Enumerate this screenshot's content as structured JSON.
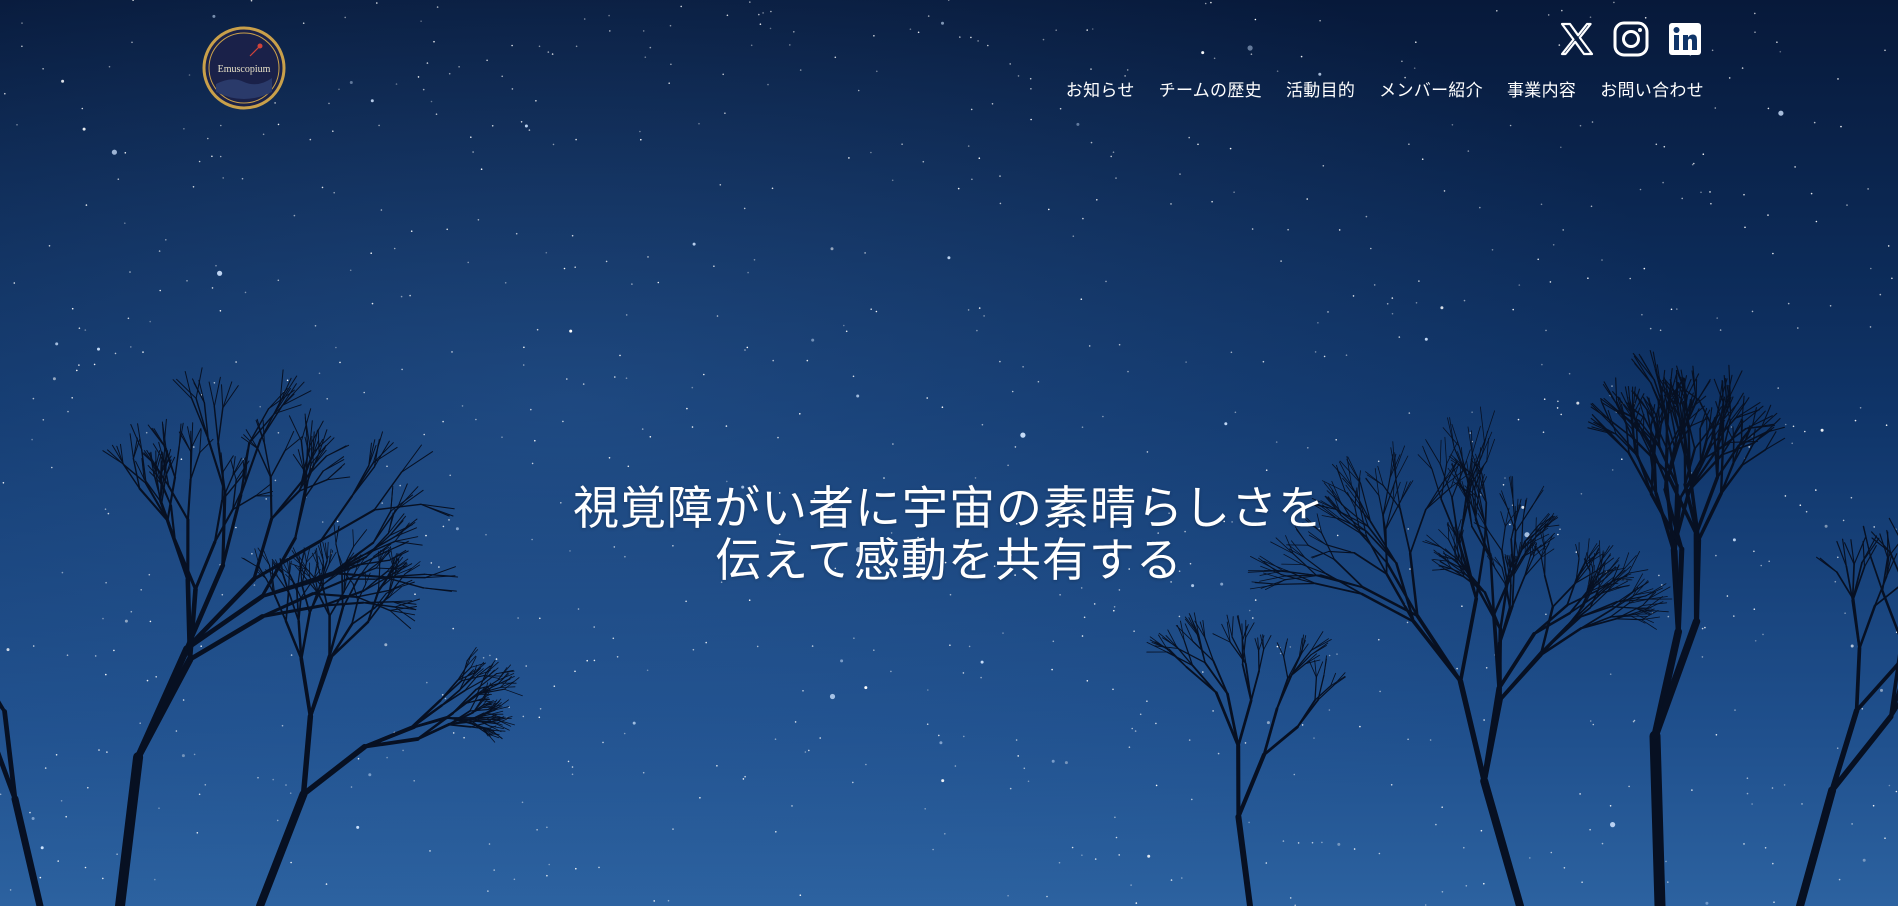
{
  "logo": {
    "text": "Emuscopium"
  },
  "social": {
    "x_label": "X",
    "instagram_label": "Instagram",
    "linkedin_label": "LinkedIn"
  },
  "nav": {
    "items": [
      {
        "label": "お知らせ"
      },
      {
        "label": "チームの歴史"
      },
      {
        "label": "活動目的"
      },
      {
        "label": "メンバー紹介"
      },
      {
        "label": "事業内容"
      },
      {
        "label": "お問い合わせ"
      }
    ]
  },
  "hero": {
    "line1": "視覚障がい者に宇宙の素晴らしさを",
    "line2": "伝えて感動を共有する"
  },
  "colors": {
    "sky_top": "#0a1f45",
    "sky_bottom": "#2b5d96",
    "text": "#ffffff",
    "logo_ring": "#c9a04a"
  }
}
